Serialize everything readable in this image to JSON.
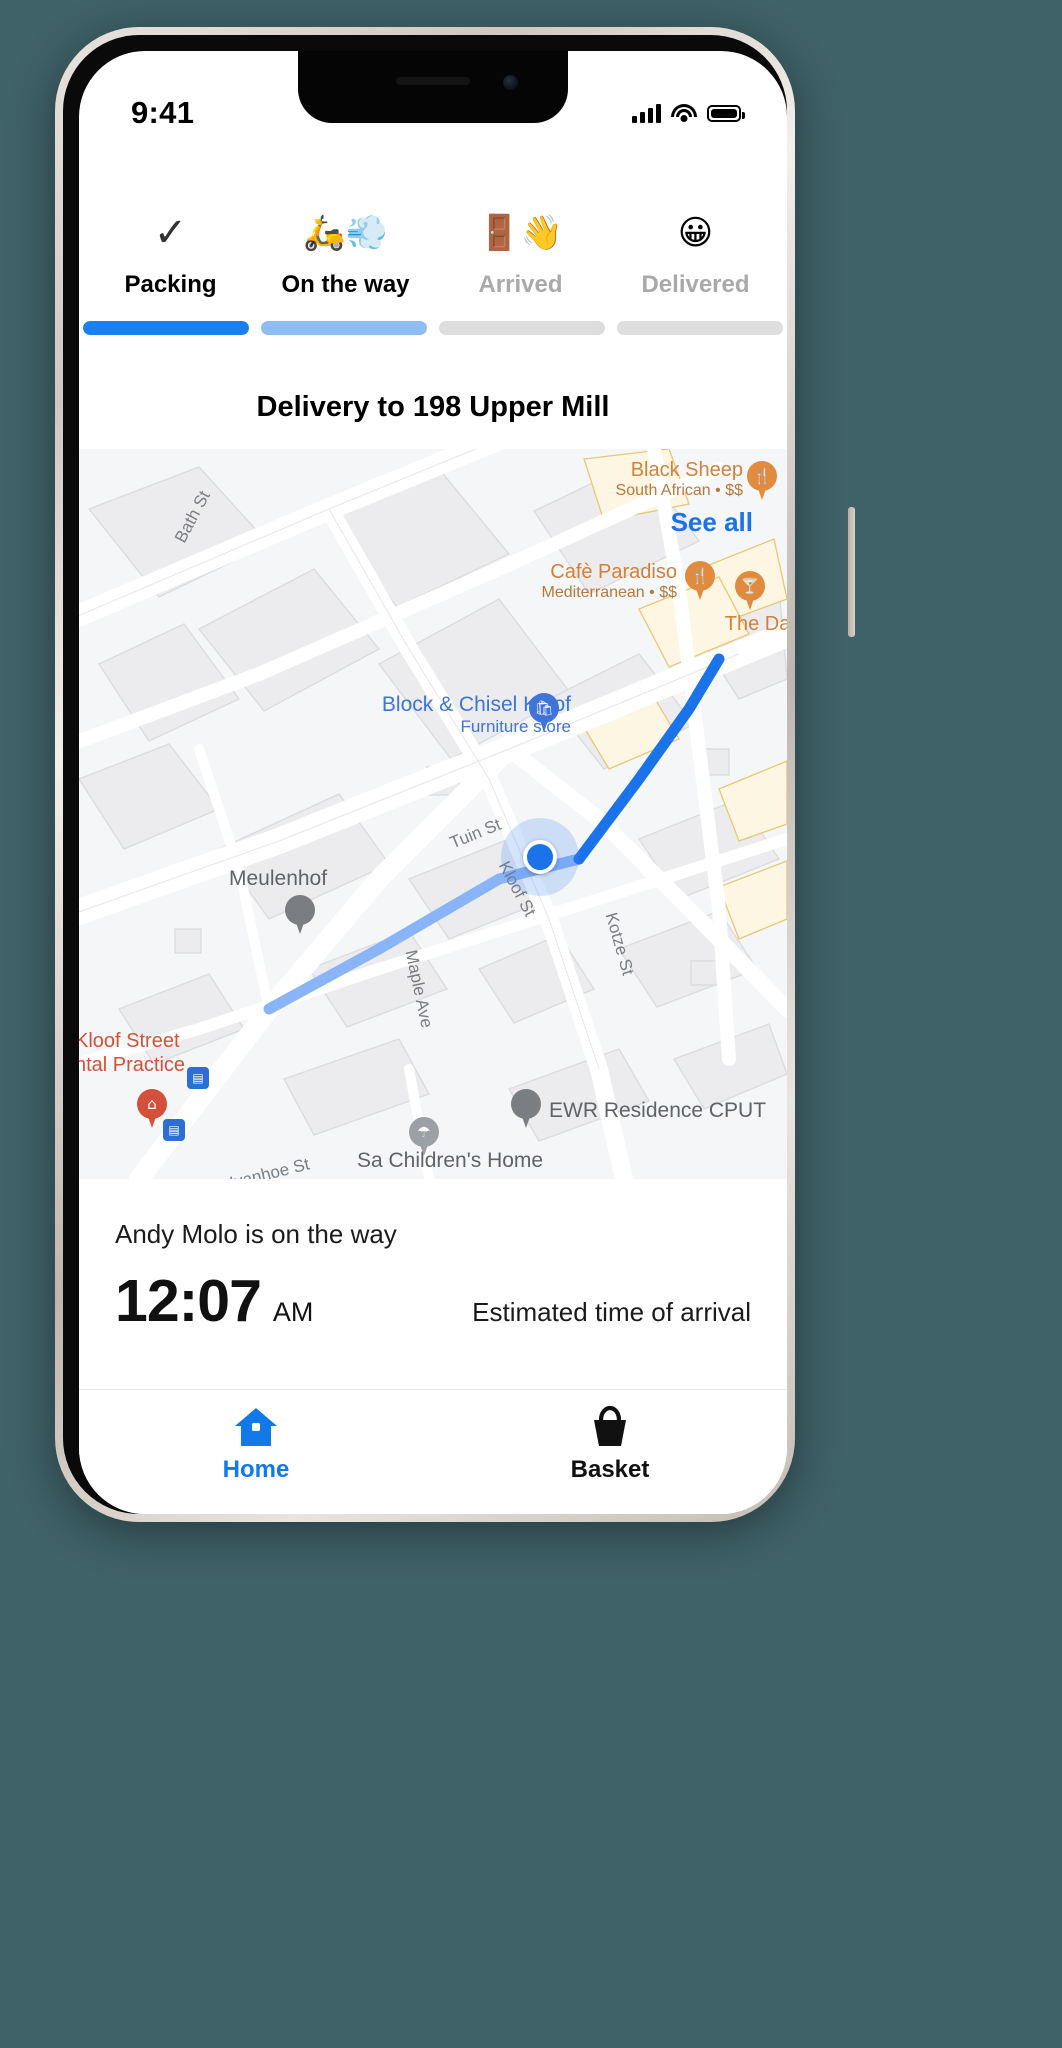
{
  "status_bar": {
    "time": "9:41",
    "signal_icon": "cellular-signal-icon",
    "wifi_icon": "wifi-icon",
    "battery_icon": "battery-icon"
  },
  "stepper": {
    "steps": [
      {
        "label": "Packing",
        "icon": "check-mark-icon",
        "glyph": "✓",
        "state": "complete",
        "progress": 100
      },
      {
        "label": "On the way",
        "icon": "scooter-icon",
        "glyph": "🛵💨",
        "state": "active",
        "progress": 55
      },
      {
        "label": "Arrived",
        "icon": "door-wave-icon",
        "glyph": "🚪👋",
        "state": "pending",
        "progress": 0
      },
      {
        "label": "Delivered",
        "icon": "smiley-face-icon",
        "glyph": "😀",
        "state": "pending",
        "progress": 0
      }
    ],
    "colors": {
      "complete": "#1a80f0",
      "active": "#8dbdf2",
      "pending": "#dddddd",
      "label_active": "#000000",
      "label_pending": "#a9a9a9"
    }
  },
  "delivery": {
    "title": "Delivery to 198 Upper Mill"
  },
  "map": {
    "see_all_label": "See all",
    "pois": [
      {
        "name": "Black Sheep",
        "subtitle": "South African • $$",
        "style": "orange",
        "icon": "restaurant-pin-icon"
      },
      {
        "name": "Cafè Paradiso",
        "subtitle": "Mediterranean • $$",
        "style": "orange",
        "icon": "restaurant-pin-icon"
      },
      {
        "name": "The Dar",
        "subtitle": "",
        "style": "orange",
        "icon": "bar-pin-icon"
      },
      {
        "name": "Block & Chisel Kloof",
        "subtitle": "Furniture store",
        "style": "blue",
        "icon": "store-pin-icon"
      },
      {
        "name": "Meulenhof",
        "subtitle": "",
        "style": "grey",
        "icon": "place-pin-icon"
      },
      {
        "name": "Kloof Street",
        "subtitle": "ntal Practice",
        "style": "red",
        "icon": "hospital-pin-icon"
      },
      {
        "name": "EWR Residence CPUT",
        "subtitle": "",
        "style": "grey",
        "icon": "place-pin-icon"
      },
      {
        "name": "Sa Children's Home",
        "subtitle": "",
        "style": "grey",
        "icon": "place-pin-icon"
      }
    ],
    "streets": [
      "Bath St",
      "Tuin St",
      "Kloof St",
      "Kotze St",
      "Maple Ave",
      "Ivanhoe St"
    ],
    "route_color": "#1a73e8",
    "route_faded_color": "#8ab4f8",
    "courier_marker": "courier-location-dot"
  },
  "sheet": {
    "courier_status": "Andy Molo is on the way",
    "eta_time": "12:07",
    "eta_ampm": "AM",
    "eta_label": "Estimated time of arrival"
  },
  "tabbar": {
    "tabs": [
      {
        "label": "Home",
        "icon": "home-icon",
        "active": true
      },
      {
        "label": "Basket",
        "icon": "basket-icon",
        "active": false
      }
    ],
    "active_color": "#127ae8",
    "idle_color": "#111111"
  }
}
